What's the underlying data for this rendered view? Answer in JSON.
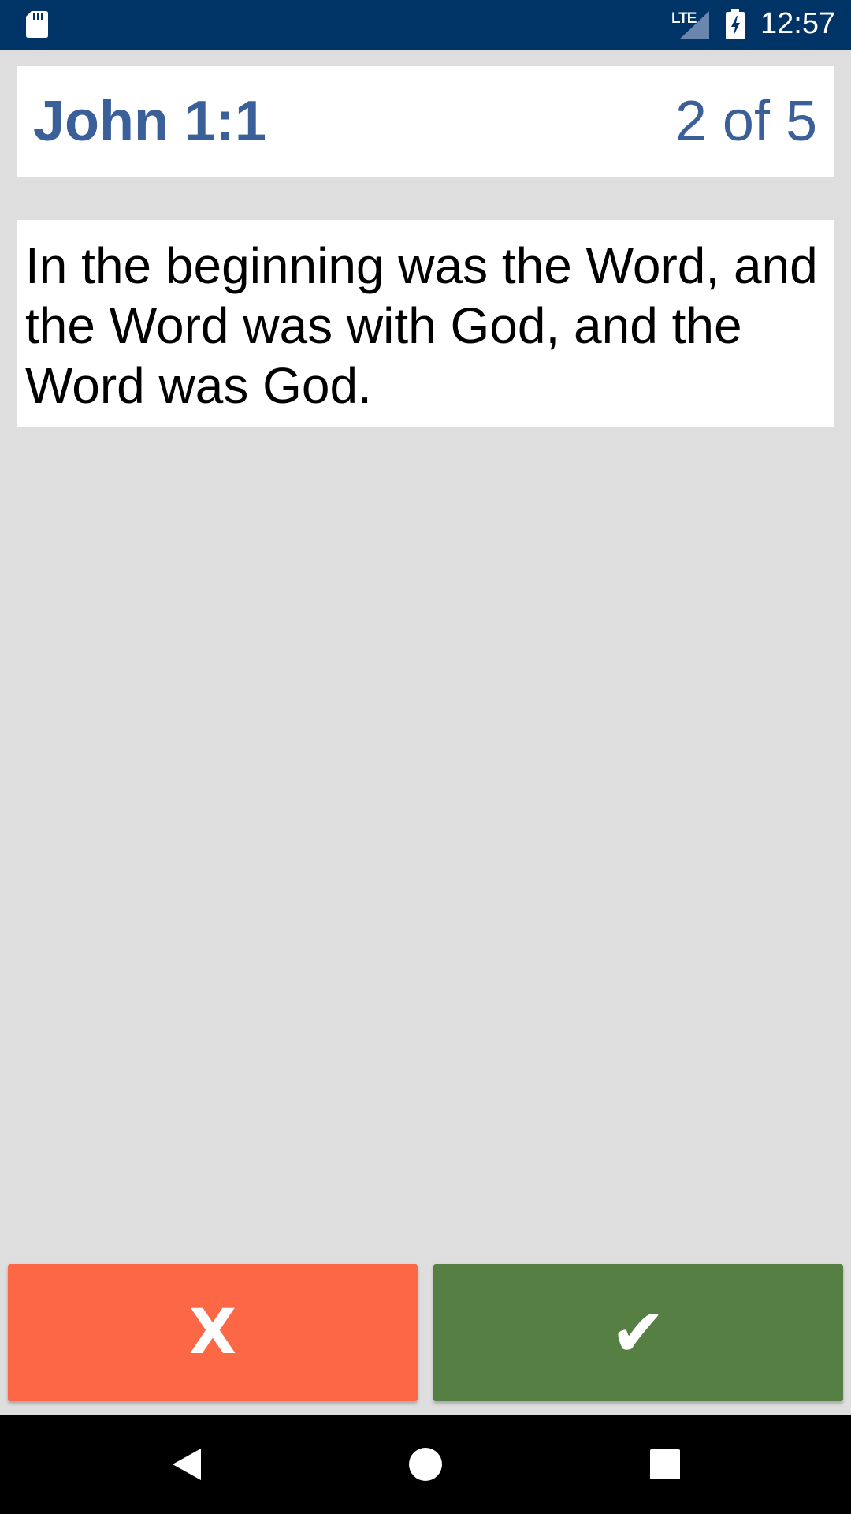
{
  "status_bar": {
    "network": "LTE",
    "time": "12:57"
  },
  "card": {
    "reference": "John 1:1",
    "progress": "2 of 5",
    "verse_text": "In the beginning was the Word, and the Word was with God, and the Word was God."
  },
  "actions": {
    "wrong_label": "X",
    "right_label": "✔"
  },
  "icons": {
    "sd_card": "sd-card-icon",
    "signal": "signal-icon",
    "battery": "battery-charging-icon",
    "back": "back-icon",
    "home": "home-icon",
    "recents": "recents-icon"
  },
  "colors": {
    "status_bar": "#003366",
    "background": "#dedede",
    "reference_text": "#3a5f99",
    "wrong_button": "#fc6745",
    "right_button": "#567f44"
  }
}
